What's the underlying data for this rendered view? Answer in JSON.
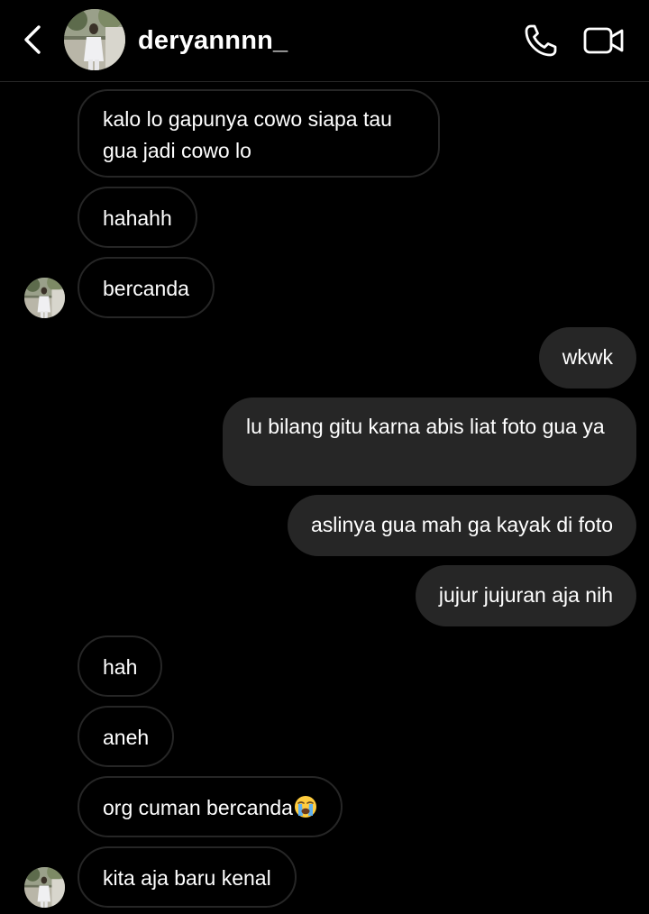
{
  "header": {
    "username": "deryannnn_",
    "back_icon": "chevron-left-icon",
    "call_icon": "phone-icon",
    "video_icon": "video-camera-icon"
  },
  "messages": [
    {
      "sender": "them",
      "text": "kalo lo gapunya cowo siapa tau gua jadi cowo lo"
    },
    {
      "sender": "them",
      "text": "hahahh"
    },
    {
      "sender": "them",
      "text": "bercanda",
      "show_avatar": true
    },
    {
      "sender": "me",
      "text": "wkwk"
    },
    {
      "sender": "me",
      "text": "lu bilang gitu karna abis liat foto gua ya"
    },
    {
      "sender": "me",
      "text": "aslinya gua mah ga kayak di foto"
    },
    {
      "sender": "me",
      "text": "jujur jujuran aja nih"
    },
    {
      "sender": "them",
      "text": "hah"
    },
    {
      "sender": "them",
      "text": "aneh"
    },
    {
      "sender": "them",
      "text": "org cuman bercanda",
      "emoji": "loudly-crying-face-icon"
    },
    {
      "sender": "them",
      "text": "kita aja baru kenal",
      "show_avatar": true
    }
  ],
  "colors": {
    "background": "#000000",
    "outgoing_bubble": "#262626",
    "incoming_border": "#262626",
    "text": "#ffffff"
  }
}
